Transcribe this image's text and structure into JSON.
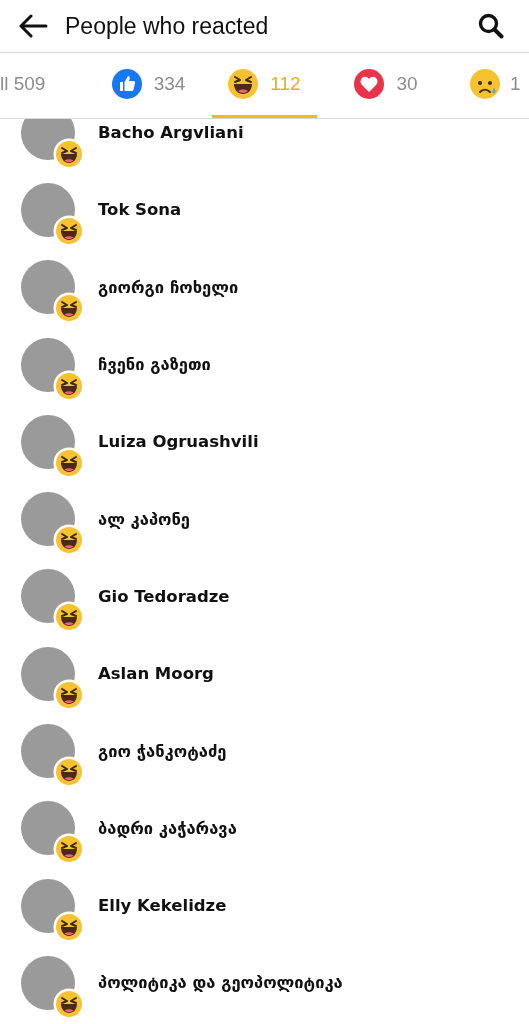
{
  "header": {
    "title": "People who reacted"
  },
  "tabs": [
    {
      "kind": "all",
      "count": "ll 509",
      "selected": false
    },
    {
      "kind": "like",
      "count": "334",
      "selected": false
    },
    {
      "kind": "haha",
      "count": "112",
      "selected": true
    },
    {
      "kind": "love",
      "count": "30",
      "selected": false
    },
    {
      "kind": "sad",
      "count": "1",
      "selected": false
    }
  ],
  "people": [
    {
      "name": "Bacho Argvliani",
      "kind": "haha"
    },
    {
      "name": "Tok Sona",
      "kind": "haha"
    },
    {
      "name": "გიორგი ჩოხელი",
      "kind": "haha"
    },
    {
      "name": "ჩვენი გაზეთი",
      "kind": "haha"
    },
    {
      "name": "Luiza Ogruashvili",
      "kind": "haha"
    },
    {
      "name": "ალ კაპონე",
      "kind": "haha"
    },
    {
      "name": "Gio Tedoradze",
      "kind": "haha"
    },
    {
      "name": "Aslan Moorg",
      "kind": "haha"
    },
    {
      "name": "გიო ჭანკოტაძე",
      "kind": "haha"
    },
    {
      "name": "ბადრი კაჭარავა",
      "kind": "haha"
    },
    {
      "name": "Elly Kekelidze",
      "kind": "haha"
    },
    {
      "name": "პოლიტიკა და გეოპოლიტიკა",
      "kind": "haha"
    }
  ]
}
